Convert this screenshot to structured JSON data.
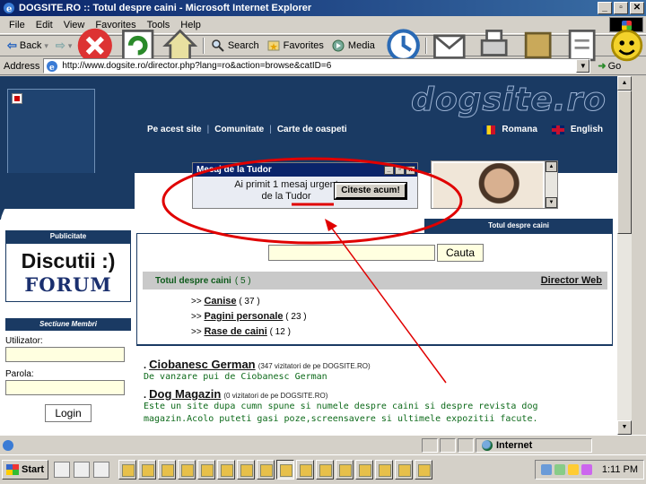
{
  "window": {
    "title": "DOGSITE.RO :: Totul despre caini - Microsoft Internet Explorer",
    "controls": [
      "_",
      "▫",
      "✕"
    ]
  },
  "menubar": {
    "items": [
      "File",
      "Edit",
      "View",
      "Favorites",
      "Tools",
      "Help"
    ]
  },
  "toolbar": {
    "back": "Back",
    "search": "Search",
    "favorites": "Favorites",
    "media": "Media"
  },
  "addressbar": {
    "label": "Address",
    "url": "http://www.dogsite.ro/director.php?lang=ro&action=browse&catID=6",
    "go": "Go"
  },
  "site": {
    "brand": "dogsite.ro",
    "nav": [
      "Pe acest site",
      "Comunitate",
      "Carte de oaspeti"
    ],
    "lang_ro": "Romana",
    "lang_en": "English",
    "tab_title": "Totul despre caini"
  },
  "popup": {
    "title": "Mesaj de la Tudor",
    "message": "Ai primit 1 mesaj urgent de la Tudor",
    "action": "Citeste acum!"
  },
  "leftcol": {
    "publicitate_head": "Publicitate",
    "pub_line1": "Discutii :)",
    "pub_line2": "FORUM",
    "members_head": "Sectiune Membri",
    "user_label": "Utilizator:",
    "pass_label": "Parola:",
    "login": "Login"
  },
  "main": {
    "search_placeholder": "",
    "search_button": "Cauta",
    "category_title": "Totul despre caini",
    "category_count": "( 5 )",
    "director_link": "Director Web",
    "subcategories": [
      {
        "prefix": ">>",
        "name": "Canise",
        "count": "( 37 )"
      },
      {
        "prefix": ">>",
        "name": "Pagini personale",
        "count": "( 23 )"
      },
      {
        "prefix": ">>",
        "name": "Rase de caini",
        "count": "( 12 )"
      }
    ],
    "listings": [
      {
        "title": "Ciobanesc German",
        "visits": "(347 vizitatori de pe DOGSITE.RO)",
        "desc": "De vanzare pui de Ciobanesc German"
      },
      {
        "title": "Dog Magazin",
        "visits": "(0 vizitatori de pe DOGSITE.RO)",
        "desc": "Este un site dupa cumn spune si numele despre caini si despre revista dog magazin.Acolo puteti gasi poze,screensavere si ultimele expozitii facute."
      }
    ]
  },
  "statusbar": {
    "zone": "Internet"
  },
  "taskbar": {
    "start": "Start",
    "clock": "1:11 PM"
  },
  "colors": {
    "site_navy": "#1a3a63",
    "annotation_red": "#e00000",
    "title_blue": "#0a246a"
  }
}
